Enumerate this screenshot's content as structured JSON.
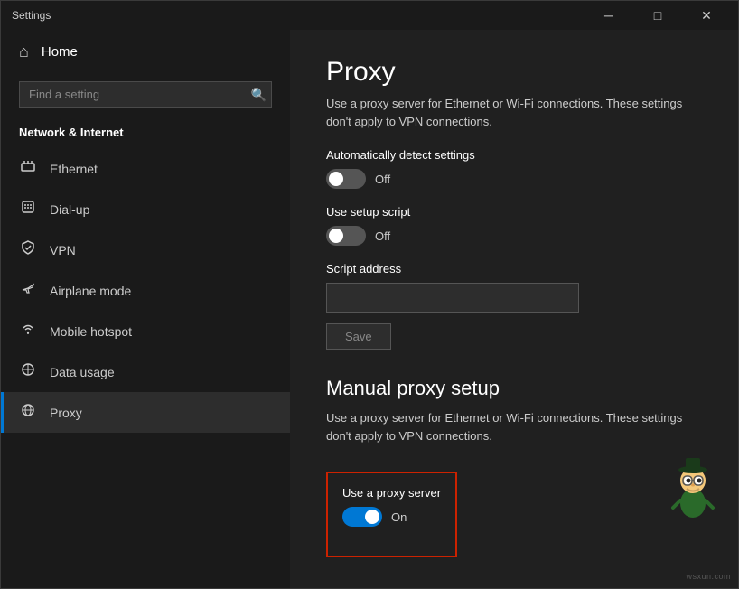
{
  "window": {
    "title": "Settings",
    "controls": {
      "minimize": "─",
      "maximize": "□",
      "close": "✕"
    }
  },
  "sidebar": {
    "home_label": "Home",
    "search_placeholder": "Find a setting",
    "section_header": "Network & Internet",
    "nav_items": [
      {
        "id": "ethernet",
        "label": "Ethernet",
        "icon": "🖧"
      },
      {
        "id": "dialup",
        "label": "Dial-up",
        "icon": "📞"
      },
      {
        "id": "vpn",
        "label": "VPN",
        "icon": "🔒"
      },
      {
        "id": "airplane",
        "label": "Airplane mode",
        "icon": "✈"
      },
      {
        "id": "hotspot",
        "label": "Mobile hotspot",
        "icon": "📶"
      },
      {
        "id": "datausage",
        "label": "Data usage",
        "icon": "⊕"
      },
      {
        "id": "proxy",
        "label": "Proxy",
        "icon": "🌐",
        "active": true
      }
    ]
  },
  "main": {
    "page_title": "Proxy",
    "auto_proxy_desc": "Use a proxy server for Ethernet or Wi-Fi connections. These settings don't apply to VPN connections.",
    "auto_detect_label": "Automatically detect settings",
    "auto_detect_state": "Off",
    "setup_script_label": "Use setup script",
    "setup_script_state": "Off",
    "script_address_label": "Script address",
    "script_address_placeholder": "",
    "save_label": "Save",
    "manual_title": "Manual proxy setup",
    "manual_desc": "Use a proxy server for Ethernet or Wi-Fi connections. These settings don't apply to VPN connections.",
    "proxy_server_label": "Use a proxy server",
    "proxy_server_state": "On",
    "watermark": "wsxun.com"
  }
}
